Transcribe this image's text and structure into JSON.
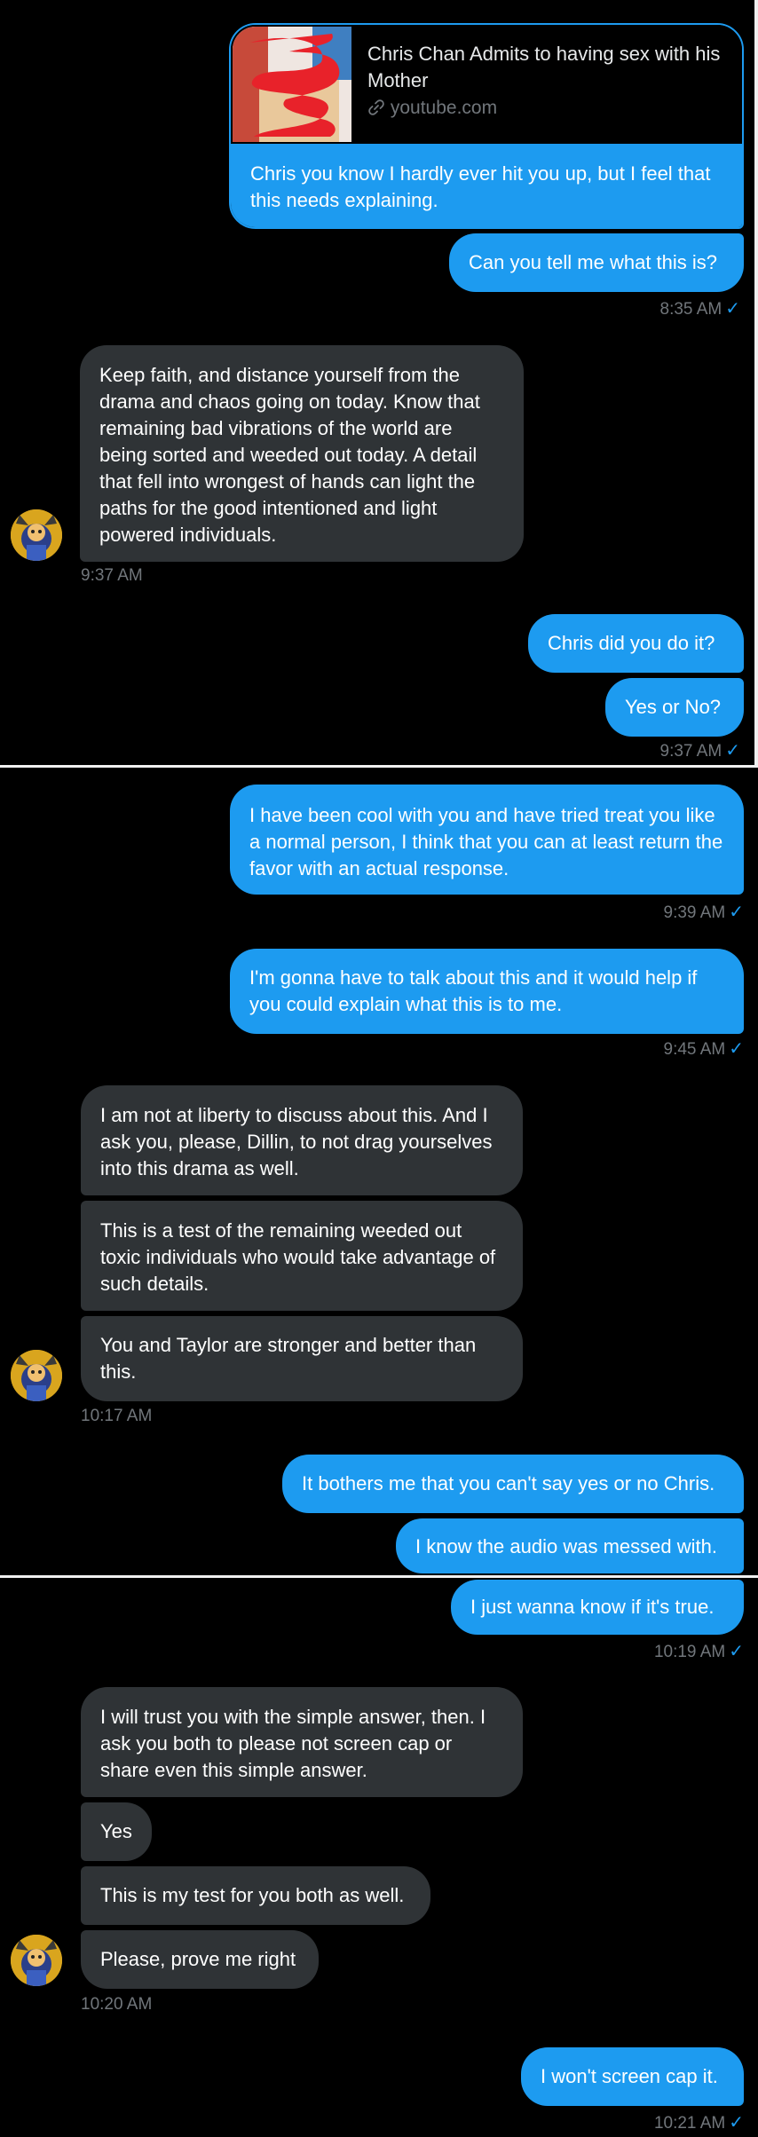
{
  "colors": {
    "sent_bubble": "#1d9bf0",
    "received_bubble": "#2f3336",
    "background": "#000000",
    "timestamp": "#71767b"
  },
  "link_card": {
    "title": "Chris Chan Admits to having sex with his Mother",
    "domain": "youtube.com",
    "domain_icon": "link-icon",
    "message": "Chris you know I hardly ever hit you up, but I feel that this needs explaining."
  },
  "messages": {
    "m1": "Can you tell me what this is?",
    "t1": "8:35 AM",
    "m2": "Keep faith, and distance yourself from the drama and chaos going on today.  Know that remaining bad vibrations of the world are being sorted and weeded out today.  A detail that fell into wrongest of hands can light the paths for the good intentioned and light powered individuals.",
    "t2": "9:37 AM",
    "m3": "Chris did you do it?",
    "m4": "Yes or No?",
    "t3": "9:37 AM",
    "m5": "I have been cool with you and have tried treat you like a normal person, I think that you can at least return the favor with an actual response.",
    "t4": "9:39 AM",
    "m6": "I'm gonna have to talk about this and it would help if you could explain what this is to me.",
    "t5": "9:45 AM",
    "m7": "I am not at liberty to discuss about this.  And I ask you, please, Dillin, to not drag yourselves into this drama as well.",
    "m8": "This is a test of the remaining weeded out toxic individuals who would take advantage of such details.",
    "m9": "You and Taylor are stronger and better than this.",
    "t6": "10:17 AM",
    "m10": "It bothers me that you can't say yes or no Chris.",
    "m11": "I know the audio was messed with.",
    "m12": "I just wanna know if it's true.",
    "t7": "10:19 AM",
    "m13": "I will trust you with the simple answer, then.  I ask you both to please not screen cap or share even this simple answer.",
    "m14": "Yes",
    "m15": "This is my test for you both as well.",
    "m16": "Please, prove me right",
    "t8": "10:20 AM",
    "m17": "I won't screen cap it.",
    "t9": "10:21 AM",
    "read_check": "✓"
  }
}
